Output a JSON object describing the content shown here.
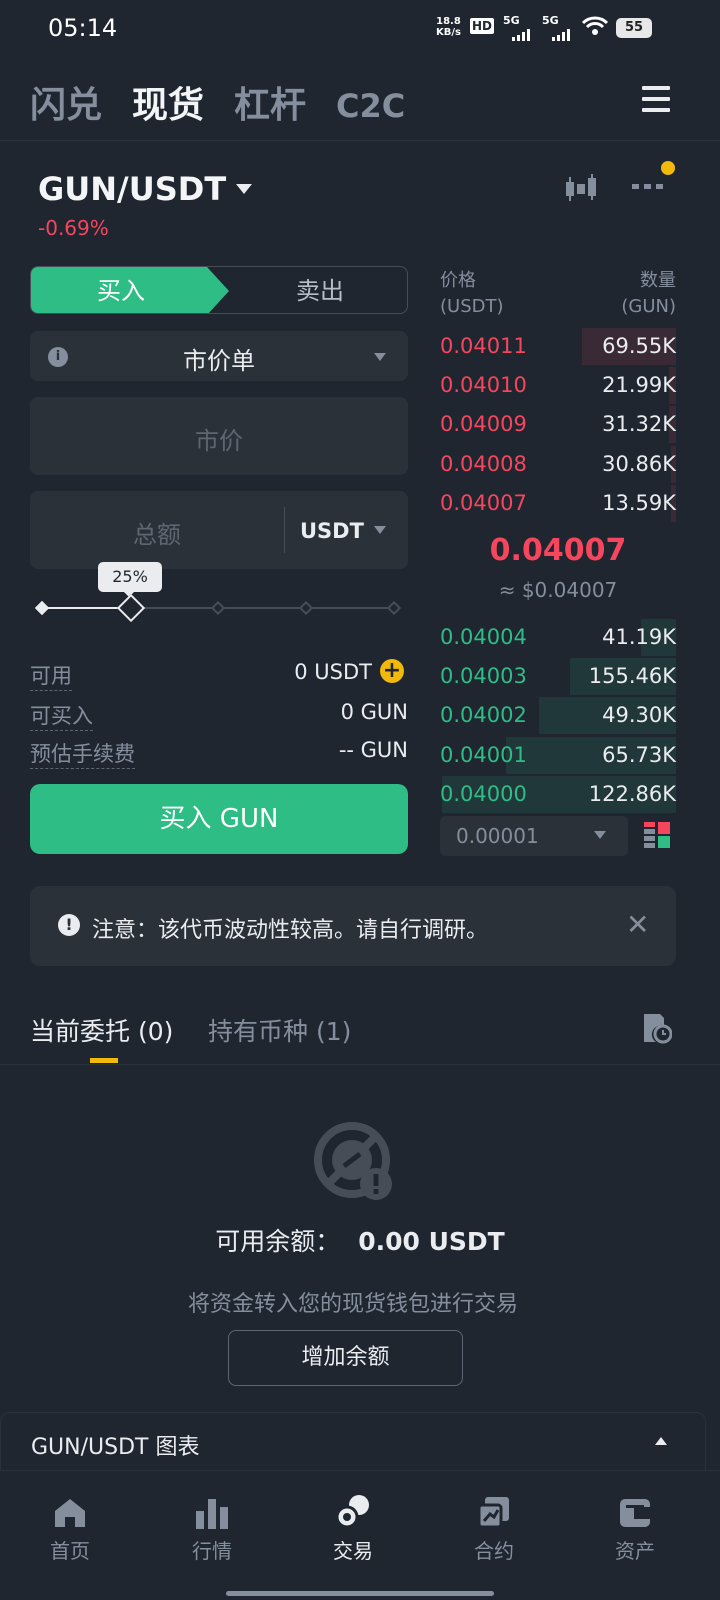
{
  "status": {
    "time": "05:14",
    "net_speed_top": "18.8",
    "net_speed_unit": "KB/s",
    "hd": "HD",
    "sig1": "5G",
    "sig2": "5G",
    "battery": "55"
  },
  "nav": {
    "tabs": [
      "闪兑",
      "现货",
      "杠杆",
      "C2C"
    ],
    "active": "现货"
  },
  "pair": {
    "name": "GUN/USDT",
    "change": "-0.69%"
  },
  "order": {
    "buy_label": "买入",
    "sell_label": "卖出",
    "type": "市价单",
    "price_placeholder": "市价",
    "total_placeholder": "总额",
    "total_unit": "USDT",
    "slider_pct": "25%",
    "slider_value": 0.25,
    "available_label": "可用",
    "available_value": "0 USDT",
    "can_buy_label": "可买入",
    "can_buy_value": "0 GUN",
    "fee_label": "预估手续费",
    "fee_value": "-- GUN",
    "submit": "买入 GUN"
  },
  "orderbook": {
    "price_header": "价格",
    "price_unit": "(USDT)",
    "qty_header": "数量",
    "qty_unit": "(GUN)",
    "asks": [
      {
        "price": "0.04011",
        "qty": "69.55K",
        "depth": 0.4
      },
      {
        "price": "0.04010",
        "qty": "21.99K",
        "depth": 0.03
      },
      {
        "price": "0.04009",
        "qty": "31.32K",
        "depth": 0.03
      },
      {
        "price": "0.04008",
        "qty": "30.86K",
        "depth": 0.02
      },
      {
        "price": "0.04007",
        "qty": "13.59K",
        "depth": 0.02
      }
    ],
    "last_price": "0.04007",
    "last_price_usd": "≈ $0.04007",
    "bids": [
      {
        "price": "0.04004",
        "qty": "41.19K",
        "depth": 0.15
      },
      {
        "price": "0.04003",
        "qty": "155.46K",
        "depth": 0.45
      },
      {
        "price": "0.04002",
        "qty": "49.30K",
        "depth": 0.58
      },
      {
        "price": "0.04001",
        "qty": "65.73K",
        "depth": 0.72
      },
      {
        "price": "0.04000",
        "qty": "122.86K",
        "depth": 0.99
      }
    ],
    "precision": "0.00001"
  },
  "notice": {
    "text": "注意：该代币波动性较高。请自行调研。"
  },
  "orders_tabs": {
    "current": "当前委托",
    "current_count": "(0)",
    "holdings": "持有币种",
    "holdings_count": "(1)"
  },
  "empty": {
    "balance_label": "可用余额：",
    "balance_value": "0.00 USDT",
    "hint": "将资金转入您的现货钱包进行交易",
    "button": "增加余额"
  },
  "chart_bar": {
    "title": "GUN/USDT 图表"
  },
  "bottom_nav": [
    "首页",
    "行情",
    "交易",
    "合约",
    "资产"
  ],
  "colors": {
    "bg": "#1f2630",
    "panel": "#2b3139",
    "green": "#2ebd85",
    "red": "#f6465d",
    "accent": "#f0b90b"
  }
}
